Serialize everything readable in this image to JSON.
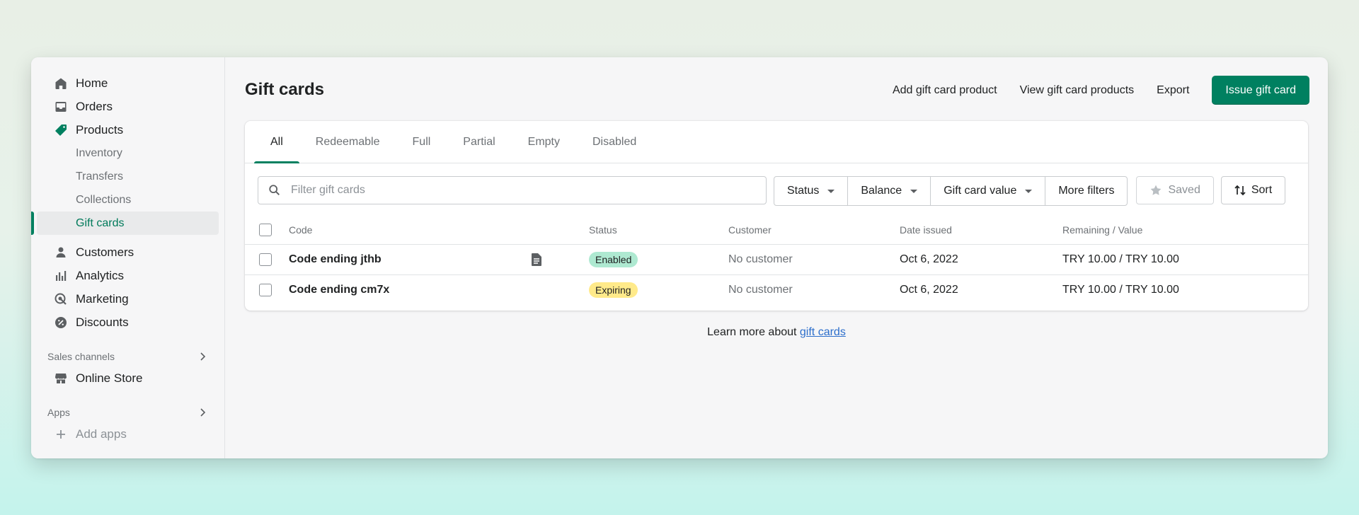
{
  "sidebar": {
    "main_items": [
      {
        "label": "Home"
      },
      {
        "label": "Orders"
      },
      {
        "label": "Products"
      }
    ],
    "product_subitems": [
      {
        "label": "Inventory"
      },
      {
        "label": "Transfers"
      },
      {
        "label": "Collections"
      },
      {
        "label": "Gift cards"
      }
    ],
    "secondary_items": [
      {
        "label": "Customers"
      },
      {
        "label": "Analytics"
      },
      {
        "label": "Marketing"
      },
      {
        "label": "Discounts"
      }
    ],
    "sales_channels_label": "Sales channels",
    "online_store_label": "Online Store",
    "apps_label": "Apps",
    "add_apps_label": "Add apps"
  },
  "header": {
    "title": "Gift cards",
    "add_product": "Add gift card product",
    "view_products": "View gift card products",
    "export": "Export",
    "issue": "Issue gift card"
  },
  "tabs": [
    "All",
    "Redeemable",
    "Full",
    "Partial",
    "Empty",
    "Disabled"
  ],
  "filters": {
    "search_placeholder": "Filter gift cards",
    "status": "Status",
    "balance": "Balance",
    "value": "Gift card value",
    "more": "More filters",
    "saved": "Saved",
    "sort": "Sort"
  },
  "table": {
    "columns": [
      "Code",
      "Status",
      "Customer",
      "Date issued",
      "Remaining / Value"
    ],
    "rows": [
      {
        "code": "Code ending jthb",
        "status": "Enabled",
        "customer": "No customer",
        "date": "Oct 6, 2022",
        "remaining": "TRY 10.00 / TRY 10.00"
      },
      {
        "code": "Code ending cm7x",
        "status": "Expiring",
        "customer": "No customer",
        "date": "Oct 6, 2022",
        "remaining": "TRY 10.00 / TRY 10.00"
      }
    ]
  },
  "footer": {
    "learn_text": "Learn more about ",
    "learn_link": "gift cards"
  },
  "colors": {
    "accent": "#008060",
    "enabled_badge": "#aee9d1",
    "expiring_badge": "#ffea8a",
    "link": "#2c6ecb"
  }
}
